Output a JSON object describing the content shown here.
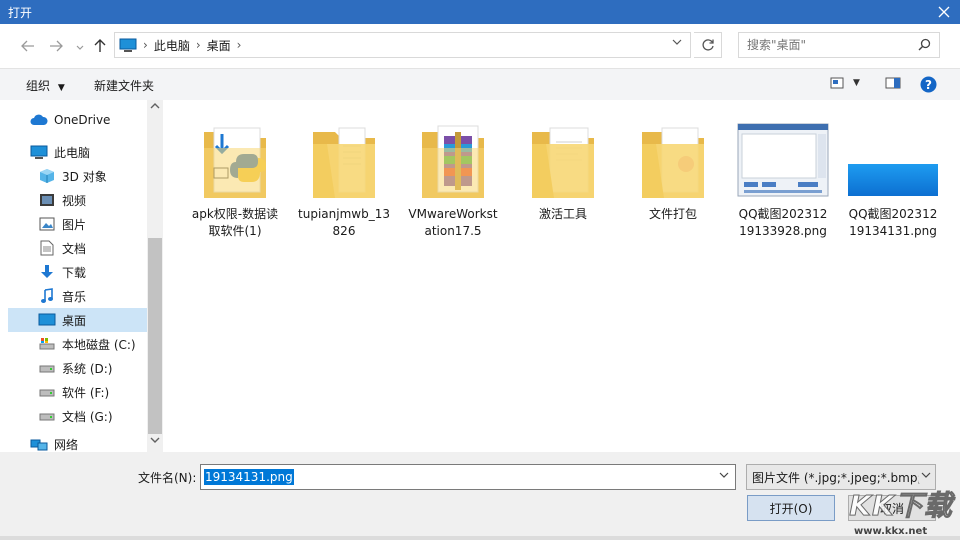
{
  "window": {
    "title": "打开"
  },
  "address": {
    "crumbs": [
      "此电脑",
      "桌面"
    ]
  },
  "search": {
    "placeholder": "搜索\"桌面\""
  },
  "toolbar": {
    "organize": "组织",
    "new_folder": "新建文件夹"
  },
  "sidebar": {
    "items": [
      {
        "label": "OneDrive",
        "icon": "cloud-icon"
      },
      {
        "label": "此电脑",
        "icon": "computer-icon"
      },
      {
        "label": "3D 对象",
        "icon": "cube-icon"
      },
      {
        "label": "视频",
        "icon": "video-icon"
      },
      {
        "label": "图片",
        "icon": "picture-icon"
      },
      {
        "label": "文档",
        "icon": "document-icon"
      },
      {
        "label": "下载",
        "icon": "download-icon"
      },
      {
        "label": "音乐",
        "icon": "music-icon"
      },
      {
        "label": "桌面",
        "icon": "desktop-icon",
        "selected": true
      },
      {
        "label": "本地磁盘 (C:)",
        "icon": "drive-c-icon"
      },
      {
        "label": "系统 (D:)",
        "icon": "drive-icon"
      },
      {
        "label": "软件 (F:)",
        "icon": "drive-icon"
      },
      {
        "label": "文档 (G:)",
        "icon": "drive-icon"
      },
      {
        "label": "网络",
        "icon": "network-icon"
      }
    ]
  },
  "files": [
    {
      "name": "apk权限-数据读取软件(1)",
      "kind": "python-folder"
    },
    {
      "name": "tupianjmwb_13826",
      "kind": "folder"
    },
    {
      "name": "VMwareWorkstation17.5",
      "kind": "winrar-folder"
    },
    {
      "name": "激活工具",
      "kind": "folder"
    },
    {
      "name": "文件打包",
      "kind": "folder"
    },
    {
      "name": "QQ截图20231219133928.png",
      "kind": "screenshot"
    },
    {
      "name": "QQ截图20231219134131.png",
      "kind": "image-blue"
    }
  ],
  "bottom": {
    "filename_label": "文件名(N):",
    "filename_value": "19134131.png",
    "filetype_value": "图片文件 (*.jpg;*.jpeg;*.bmp;*",
    "open_label": "打开(O)",
    "cancel_label": "取消"
  },
  "watermark": {
    "text": "KK下载",
    "url": "www.kkx.net"
  },
  "colors": {
    "titlebar": "#2e6dbf",
    "selection": "#cce4f7",
    "folder": "#f7d775",
    "accent": "#0078d7"
  }
}
